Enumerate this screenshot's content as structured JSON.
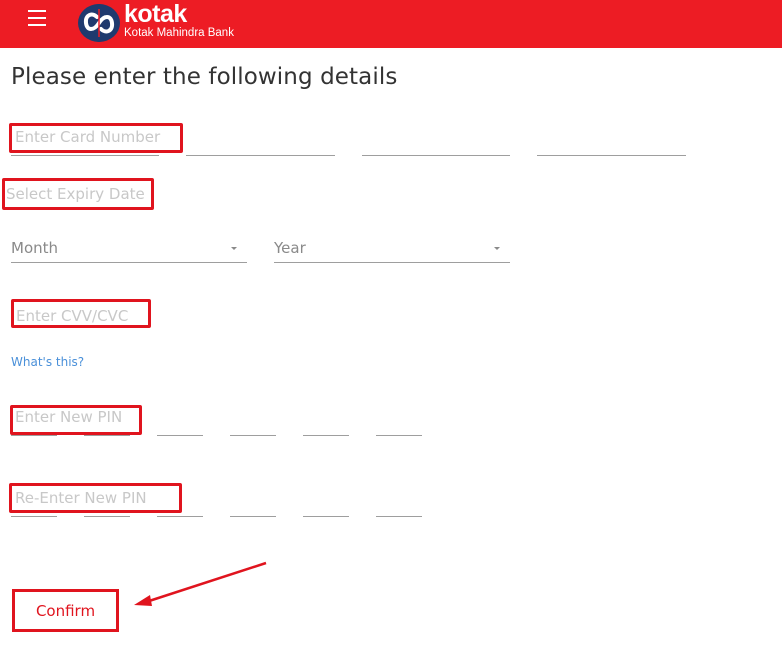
{
  "header": {
    "brand_name": "kotak",
    "brand_sub": "Kotak Mahindra Bank",
    "menu_icon": "hamburger-icon",
    "logo_icon": "kotak-infinity-logo",
    "colors": {
      "bar": "#ed1c24",
      "logo_circle": "#1f3a6e"
    }
  },
  "page": {
    "title": "Please enter the following details"
  },
  "form": {
    "card_number": {
      "placeholder": "Enter Card Number",
      "segments": 4
    },
    "expiry": {
      "label": "Select Expiry Date",
      "month": {
        "selected": "Month"
      },
      "year": {
        "selected": "Year"
      }
    },
    "cvv": {
      "placeholder": "Enter CVV/CVC",
      "help_link": "What's this?"
    },
    "new_pin": {
      "placeholder": "Enter New PIN",
      "digits": 6
    },
    "reenter_pin": {
      "placeholder": "Re-Enter New PIN",
      "digits": 6
    },
    "confirm_label": "Confirm"
  },
  "annotation": {
    "color": "#e0141e",
    "arrow_target": "confirm-button"
  }
}
